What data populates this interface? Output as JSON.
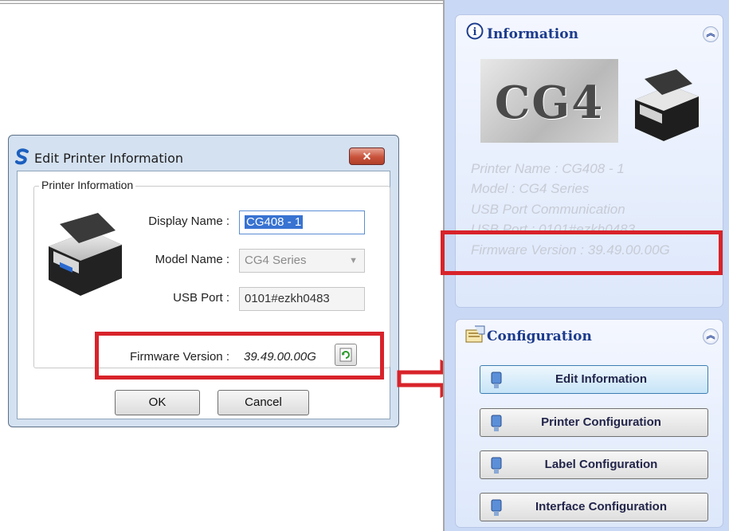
{
  "dialog": {
    "title": "Edit Printer Information",
    "close_label": "✕",
    "group_label": "Printer Information",
    "display_name_label": "Display Name :",
    "display_name_value": "CG408 - 1",
    "model_name_label": "Model Name :",
    "model_name_value": "CG4 Series",
    "usb_port_label": "USB Port :",
    "usb_port_value": "0101#ezkh0483",
    "firmware_label": "Firmware Version :",
    "firmware_value": "39.49.00.00G",
    "ok_label": "OK",
    "cancel_label": "Cancel"
  },
  "info_panel": {
    "title": "Information",
    "logo_text": "CG4",
    "lines": [
      "Printer Name : CG408 - 1",
      "Model : CG4 Series",
      "USB Port Communication",
      "USB Port : 0101#ezkh0483",
      "Firmware Version : 39.49.00.00G"
    ]
  },
  "config_panel": {
    "title": "Configuration",
    "buttons": [
      "Edit Information",
      "Printer Configuration",
      "Label Configuration",
      "Interface Configuration"
    ]
  },
  "colors": {
    "highlight": "#d8232a",
    "panel_title": "#1c3b8c",
    "dialog_frame": "#d4e1f0"
  },
  "icons": [
    "app-s-icon",
    "close-icon",
    "refresh-icon",
    "info-icon",
    "config-icon",
    "printer-icon",
    "chevron-up-icon",
    "arrow-right-icon"
  ]
}
